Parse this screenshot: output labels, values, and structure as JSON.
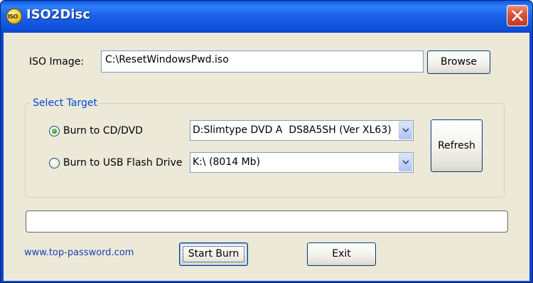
{
  "window": {
    "title": "ISO2Disc",
    "icon_text": "ISO"
  },
  "iso": {
    "label": "ISO Image:",
    "value": "C:\\ResetWindowsPwd.iso",
    "browse_label": "Browse"
  },
  "target": {
    "group_title": "Select Target",
    "cd_dvd": {
      "label": "Burn to CD/DVD",
      "selected": true,
      "device": "D:Slimtype DVD A  DS8A5SH (Ver XL63)"
    },
    "usb": {
      "label": "Burn to USB Flash Drive",
      "selected": false,
      "device": "K:\\ (8014 Mb)"
    },
    "refresh_label": "Refresh"
  },
  "progress": {
    "value_percent": 0
  },
  "footer": {
    "link_text": "www.top-password.com",
    "start_label": "Start Burn",
    "exit_label": "Exit"
  },
  "colors": {
    "titlebar": "#0a47ce",
    "client_bg": "#ece9d8",
    "group_title": "#0046d5",
    "link": "#1a3fb5"
  }
}
